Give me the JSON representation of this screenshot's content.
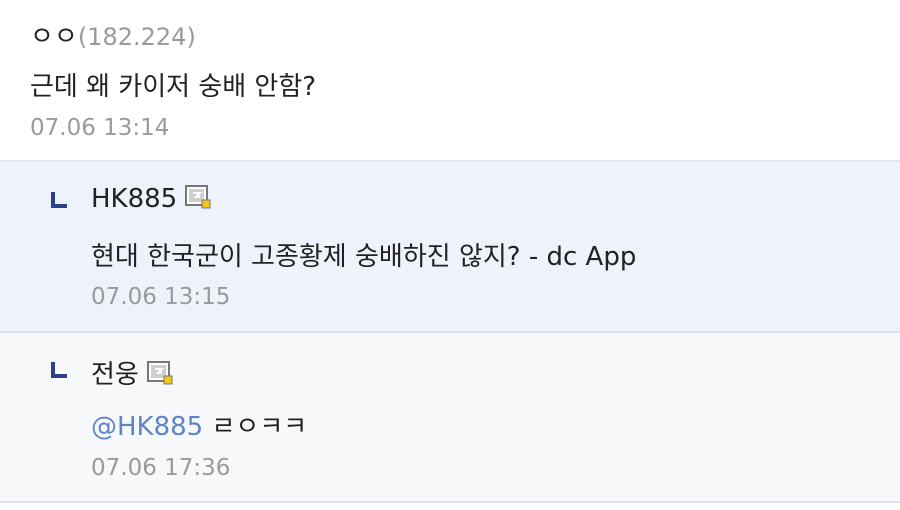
{
  "comments": [
    {
      "nick": "ㅇㅇ",
      "ip": "(182.224)",
      "text": "근데 왜 카이저 숭배 안함?",
      "date": "07.06 13:14"
    },
    {
      "nick": "HK885",
      "badge_icon": "gallog-badge-icon",
      "text": "현대 한국군이 고종황제 숭배하진 않지? - dc App",
      "date": "07.06 13:15"
    },
    {
      "nick": "전웅",
      "badge_icon": "gallog-badge-icon",
      "mention": "@HK885",
      "text": " ㄹㅇㅋㅋ",
      "date": "07.06 17:36"
    }
  ],
  "colors": {
    "reply_bg": "#eef2fa",
    "reply2_bg": "#f7f8fa",
    "mention": "#5f86c4",
    "date": "#9a9a9a",
    "reply_arrow": "#2d3f86"
  }
}
